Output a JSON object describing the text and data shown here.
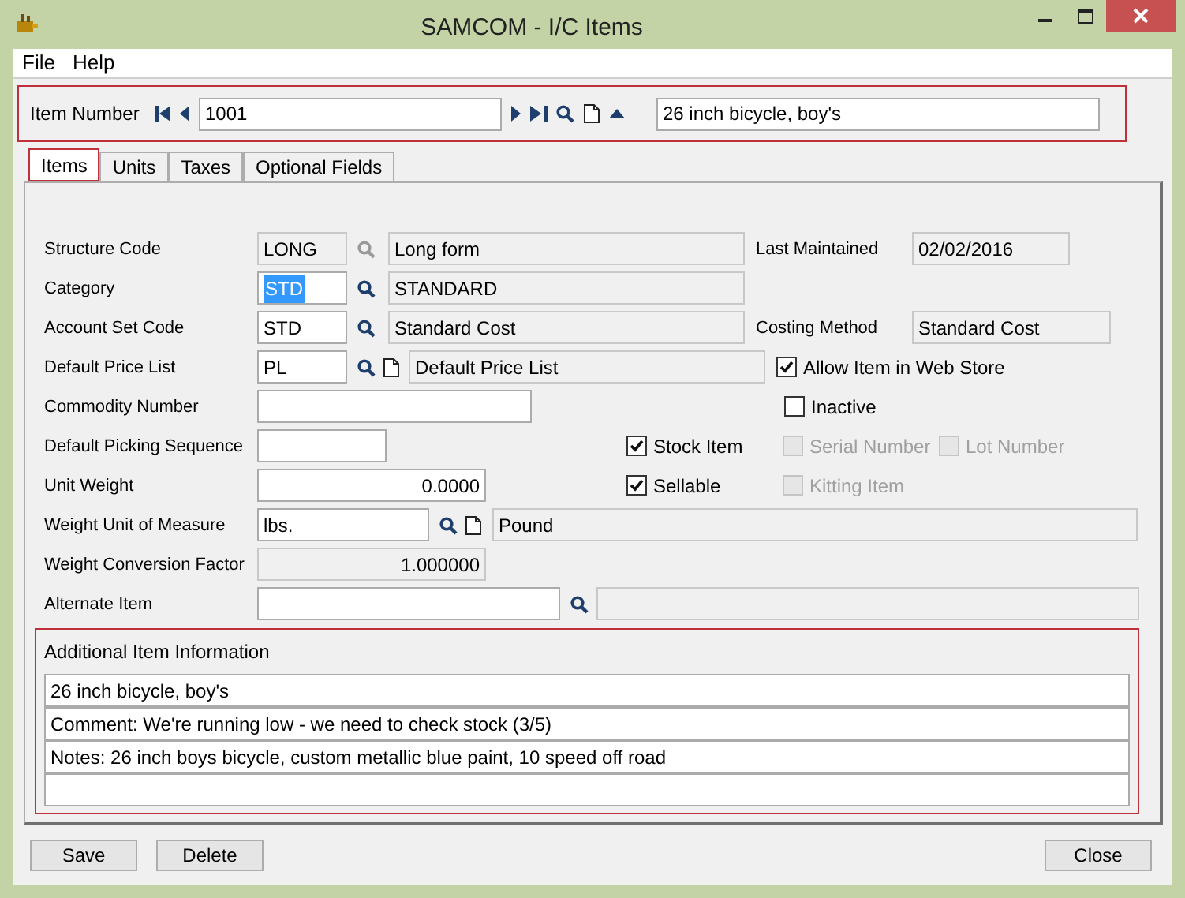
{
  "window": {
    "title": "SAMCOM - I/C Items"
  },
  "menu": [
    "File",
    "Help"
  ],
  "header": {
    "highlighted": true,
    "label": "Item Number",
    "item_number": "1001",
    "description": "26 inch bicycle, boy's"
  },
  "tabs": [
    {
      "label": "Items",
      "selected": true,
      "highlighted": true
    },
    {
      "label": "Units",
      "selected": false,
      "highlighted": false
    },
    {
      "label": "Taxes",
      "selected": false,
      "highlighted": false
    },
    {
      "label": "Optional Fields",
      "selected": false,
      "highlighted": false
    }
  ],
  "rows": [
    {
      "items": [
        {
          "kind": "label",
          "text": "Structure Code"
        },
        {
          "kind": "field",
          "value": "LONG",
          "disabled": true,
          "selected": false
        },
        {
          "kind": "finder",
          "disabled": true
        },
        {
          "kind": "field",
          "value": "Long form",
          "disabled": true,
          "selected": false
        },
        {
          "kind": "label",
          "text": "Last Maintained"
        },
        {
          "kind": "field",
          "value": "02/02/2016",
          "disabled": true,
          "selected": false
        }
      ]
    },
    {
      "items": [
        {
          "kind": "label",
          "text": "Category"
        },
        {
          "kind": "field",
          "value": "STD",
          "disabled": false,
          "selected": true
        },
        {
          "kind": "finder",
          "disabled": false
        },
        {
          "kind": "field",
          "value": "STANDARD",
          "disabled": true,
          "selected": false
        }
      ]
    },
    {
      "items": [
        {
          "kind": "label",
          "text": "Account Set Code"
        },
        {
          "kind": "field",
          "value": "STD",
          "disabled": false,
          "selected": false
        },
        {
          "kind": "finder",
          "disabled": false
        },
        {
          "kind": "field",
          "value": "Standard Cost",
          "disabled": true,
          "selected": false
        },
        {
          "kind": "label",
          "text": "Costing Method"
        },
        {
          "kind": "field",
          "value": "Standard Cost",
          "disabled": true,
          "selected": false
        }
      ]
    },
    {
      "items": [
        {
          "kind": "label",
          "text": "Default Price List"
        },
        {
          "kind": "field",
          "value": "PL",
          "disabled": false,
          "selected": false
        },
        {
          "kind": "finder",
          "disabled": false
        },
        {
          "kind": "new"
        },
        {
          "kind": "field",
          "value": "Default Price List",
          "disabled": true,
          "selected": false
        },
        {
          "kind": "checkbox",
          "label": "Allow Item in Web Store",
          "checked": true,
          "disabled": false
        }
      ]
    },
    {
      "items": [
        {
          "kind": "label",
          "text": "Commodity Number"
        },
        {
          "kind": "field",
          "disabled": false
        },
        {
          "kind": "checkbox",
          "label": "Inactive",
          "checked": false,
          "disabled": false
        }
      ]
    },
    {
      "items": [
        {
          "kind": "label",
          "text": "Default Picking Sequence"
        },
        {
          "kind": "field",
          "disabled": false
        },
        {
          "kind": "checkbox",
          "label": "Stock Item",
          "checked": true,
          "disabled": false
        },
        {
          "kind": "checkbox",
          "label": "Serial Number",
          "checked": false,
          "disabled": true
        },
        {
          "kind": "checkbox",
          "label": "Lot Number",
          "checked": false,
          "disabled": true
        }
      ]
    },
    {
      "items": [
        {
          "kind": "label",
          "text": "Unit Weight"
        },
        {
          "kind": "field",
          "value": "0.0000",
          "disabled": false,
          "selected": false
        },
        {
          "kind": "checkbox",
          "label": "Sellable",
          "checked": true,
          "disabled": false
        },
        {
          "kind": "checkbox",
          "label": "Kitting Item",
          "checked": false,
          "disabled": true
        }
      ]
    },
    {
      "items": [
        {
          "kind": "label",
          "text": "Weight Unit of Measure"
        },
        {
          "kind": "field",
          "value": "lbs.",
          "disabled": false,
          "selected": false
        },
        {
          "kind": "finder",
          "disabled": false
        },
        {
          "kind": "new"
        },
        {
          "kind": "field",
          "value": "Pound",
          "disabled": true,
          "selected": false
        }
      ]
    },
    {
      "items": [
        {
          "kind": "label",
          "text": "Weight Conversion Factor"
        },
        {
          "kind": "field",
          "value": "1.000000",
          "disabled": true,
          "selected": false
        }
      ]
    },
    {
      "items": [
        {
          "kind": "label",
          "text": "Alternate Item"
        },
        {
          "kind": "field",
          "disabled": false
        },
        {
          "kind": "finder",
          "disabled": false
        },
        {
          "kind": "field",
          "disabled": true
        }
      ]
    }
  ],
  "additional_info": {
    "highlighted": true,
    "title": "Additional Item Information",
    "lines": [
      "26 inch bicycle, boy's",
      "Comment: We're running low - we need to check stock (3/5)",
      "Notes: 26 inch boys bicycle, custom metallic blue paint, 10 speed off road"
    ]
  },
  "buttons_left": [
    "Save",
    "Delete"
  ],
  "buttons_right": [
    "Close"
  ]
}
